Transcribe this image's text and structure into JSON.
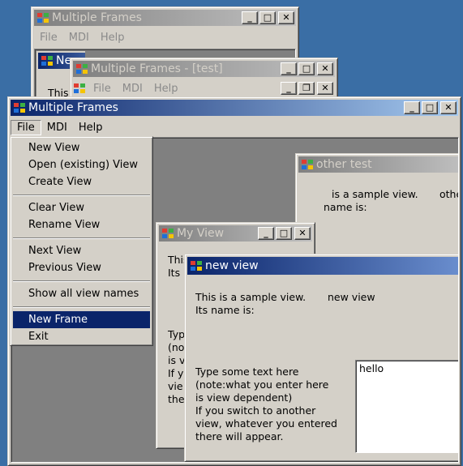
{
  "win_back": {
    "title": "Multiple Frames",
    "menu": [
      "File",
      "MDI",
      "Help"
    ],
    "child_title_partial": "Ne",
    "child_text_partial": "This"
  },
  "win_test": {
    "title": "Multiple Frames - [test]",
    "menu": [
      "File",
      "MDI",
      "Help"
    ]
  },
  "win_main": {
    "title": "Multiple Frames",
    "menu": [
      "File",
      "MDI",
      "Help"
    ]
  },
  "file_menu": {
    "items": [
      "New View",
      "Open (existing) View",
      "Create View",
      "Clear View",
      "Rename View",
      "Next View",
      "Previous View",
      "Show all view names",
      "New Frame",
      "Exit"
    ],
    "selected": "New Frame"
  },
  "other_test": {
    "title": "other test",
    "line1": "is a sample view.",
    "name_partial": "othe",
    "line2": "name is:"
  },
  "my_view": {
    "title": "My View",
    "lines_top": [
      "This",
      "Its"
    ],
    "lines_mid": [
      "Typ",
      "(no",
      "is v",
      "If y",
      "vie",
      "the"
    ]
  },
  "new_view": {
    "title": "new view",
    "sample_text": "This is a sample view.",
    "view_name": "new view",
    "name_label": "Its name is:",
    "instructions": [
      "Type some text here",
      "(note:what you enter here",
      "is view dependent)",
      "If you switch to another",
      "view, whatever you entered",
      "there will appear."
    ],
    "edit_value": "hello"
  },
  "icons": {
    "app": "windows-logo-icon",
    "minimize": "_",
    "maximize": "□",
    "restore": "❐",
    "close": "✕"
  },
  "colors": {
    "desktop": "#3a6ea5",
    "active_title": "#0a246a",
    "selection": "#0a246a",
    "mdi_bg": "#808080"
  }
}
